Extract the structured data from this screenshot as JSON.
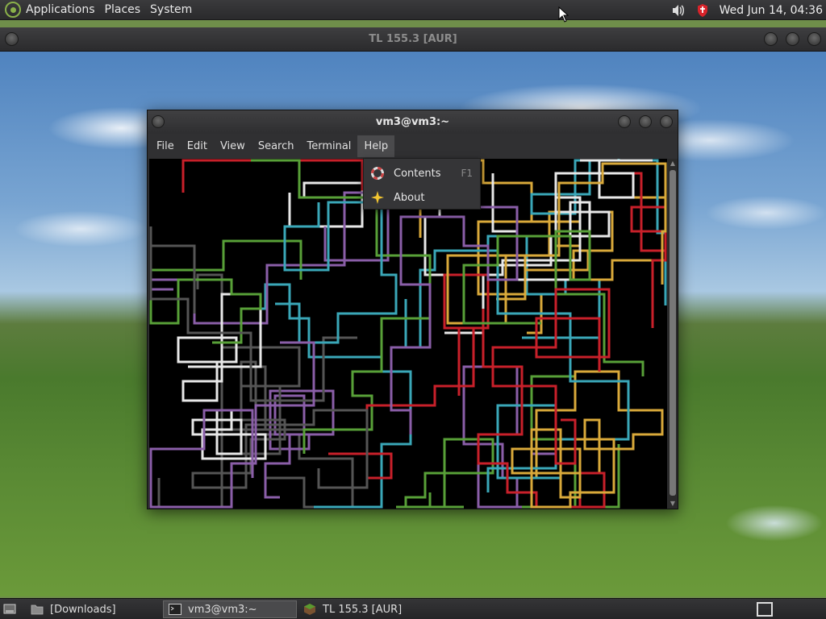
{
  "top_panel": {
    "menus": [
      "Applications",
      "Places",
      "System"
    ],
    "clock": "Wed Jun 14, 04:36"
  },
  "bg_window": {
    "title": "TL 155.3 [AUR]"
  },
  "terminal": {
    "title": "vm3@vm3:~",
    "menus": [
      "File",
      "Edit",
      "View",
      "Search",
      "Terminal",
      "Help"
    ],
    "active_menu": "Help"
  },
  "help_menu": {
    "items": [
      {
        "label": "Contents",
        "shortcut": "F1",
        "icon": "help-contents-icon"
      },
      {
        "label": "About",
        "shortcut": "",
        "icon": "about-star-icon"
      }
    ]
  },
  "taskbar": {
    "items": [
      {
        "label": "[Downloads]",
        "icon": "folder-icon"
      },
      {
        "label": "vm3@vm3:~",
        "icon": "terminal-icon"
      },
      {
        "label": "TL 155.3 [AUR]",
        "icon": "minecraft-block-icon"
      }
    ]
  },
  "pipes_colors": {
    "colors": [
      "#d9a93a",
      "#3aa7b8",
      "#e8e8e8",
      "#8a5ea8",
      "#58a038",
      "#c8202a",
      "#555555"
    ]
  }
}
